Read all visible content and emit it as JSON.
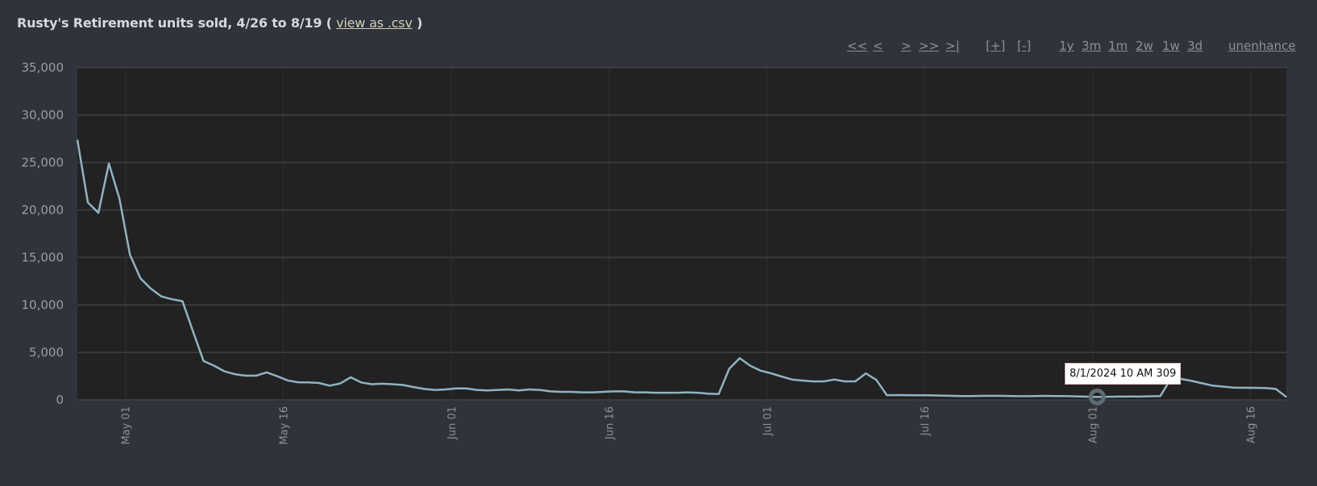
{
  "header": {
    "title": "Rusty's Retirement units sold, 4/26 to 8/19",
    "paren_open": "(",
    "csv_link": "view as .csv",
    "paren_close": ")"
  },
  "nav": {
    "first": "<<",
    "prev": "<",
    "next": ">",
    "last_page": ">>",
    "end": ">|",
    "zoom_in": "[+]",
    "zoom_out": "[-]",
    "ranges": [
      "1y",
      "3m",
      "1m",
      "2w",
      "1w",
      "3d"
    ],
    "unenhance": "unenhance"
  },
  "tooltip": {
    "text": "8/1/2024 10 AM 309"
  },
  "colors": {
    "line": "#8fb4c2",
    "plot_bg": "#222222",
    "page_bg": "#30333b",
    "highlight": "#5d6d74"
  },
  "chart_data": {
    "type": "line",
    "title": "Rusty's Retirement units sold, 4/26 to 8/19",
    "xlabel": "",
    "ylabel": "",
    "ylim": [
      0,
      35000
    ],
    "yticks": [
      "0",
      "5,000",
      "10,000",
      "15,000",
      "20,000",
      "25,000",
      "30,000",
      "35,000"
    ],
    "ytick_values": [
      0,
      5000,
      10000,
      15000,
      20000,
      25000,
      30000,
      35000
    ],
    "xticks": [
      "May 01",
      "May 16",
      "Jun 01",
      "Jun 16",
      "Jul 01",
      "Jul 16",
      "Aug 01",
      "Aug 16"
    ],
    "xtick_days": [
      5,
      20,
      36,
      51,
      66,
      81,
      97,
      112
    ],
    "x_start": "2024-04-26 10 AM",
    "x_step": "1 day",
    "grid": true,
    "highlight_index": 97,
    "series": [
      {
        "name": "units sold",
        "values": [
          27400,
          20800,
          19700,
          24900,
          21200,
          15300,
          12800,
          11700,
          10900,
          10600,
          10400,
          7200,
          4100,
          3600,
          3000,
          2700,
          2550,
          2550,
          2900,
          2500,
          2050,
          1860,
          1850,
          1780,
          1500,
          1730,
          2380,
          1840,
          1650,
          1700,
          1650,
          1570,
          1350,
          1150,
          1050,
          1100,
          1200,
          1200,
          1050,
          1000,
          1050,
          1100,
          1000,
          1100,
          1050,
          900,
          850,
          850,
          800,
          800,
          850,
          900,
          900,
          800,
          800,
          750,
          750,
          750,
          800,
          750,
          650,
          620,
          3270,
          4400,
          3600,
          3080,
          2800,
          2460,
          2140,
          2030,
          1950,
          1950,
          2140,
          1950,
          1950,
          2800,
          2100,
          500,
          510,
          500,
          490,
          480,
          460,
          430,
          410,
          400,
          420,
          430,
          420,
          400,
          390,
          410,
          420,
          410,
          400,
          370,
          340,
          309,
          330,
          350,
          360,
          350,
          380,
          400,
          2200,
          2200,
          2000,
          1750,
          1500,
          1400,
          1300,
          1280,
          1270,
          1250,
          1150,
          300
        ]
      }
    ]
  }
}
